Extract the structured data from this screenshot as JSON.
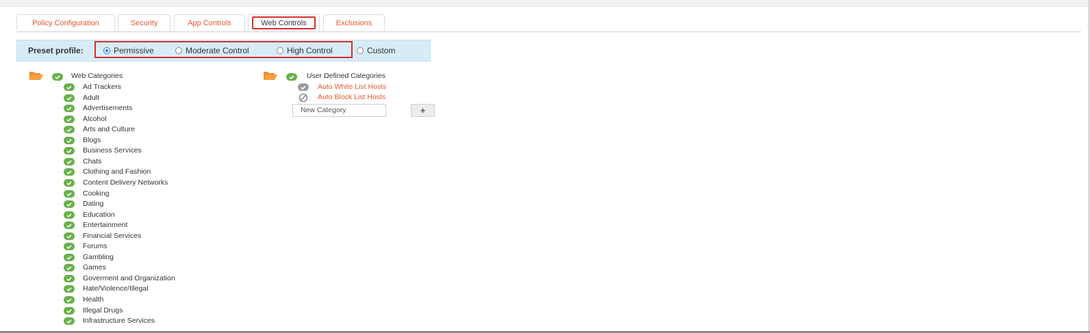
{
  "tabs": [
    {
      "label": "Policy Configuration",
      "active": false
    },
    {
      "label": "Security",
      "active": false
    },
    {
      "label": "App Controls",
      "active": false
    },
    {
      "label": "Web Controls",
      "active": true
    },
    {
      "label": "Exclusions",
      "active": false
    }
  ],
  "preset": {
    "label": "Preset profile:",
    "options": [
      {
        "label": "Permissive",
        "selected": true
      },
      {
        "label": "Moderate Control",
        "selected": false
      },
      {
        "label": "High Control",
        "selected": false
      },
      {
        "label": "Custom",
        "selected": false
      }
    ]
  },
  "web_categories": {
    "title": "Web Categories",
    "items": [
      "Ad Trackers",
      "Adult",
      "Advertisements",
      "Alcohol",
      "Arts and Culture",
      "Blogs",
      "Business Services",
      "Chats",
      "Clothing and Fashion",
      "Content Delivery Networks",
      "Cooking",
      "Dating",
      "Education",
      "Entertainment",
      "Financial Services",
      "Forums",
      "Gambling",
      "Games",
      "Goverment and Organization",
      "Hate/Violence/Illegal",
      "Health",
      "Illegal Drugs",
      "Infrastructure Services"
    ]
  },
  "user_categories": {
    "title": "User Defined Categories",
    "items": [
      {
        "label": "Auto White List Hosts",
        "icon": "check-circle-icon"
      },
      {
        "label": "Auto Block List Hosts",
        "icon": "block-icon"
      }
    ],
    "new_placeholder": "New Category",
    "add_label": "+"
  },
  "colors": {
    "accent_orange": "#e4572e",
    "check_green": "#6ab04c",
    "preset_bg": "#d6ecf6",
    "highlight_red": "#d62e2e"
  }
}
